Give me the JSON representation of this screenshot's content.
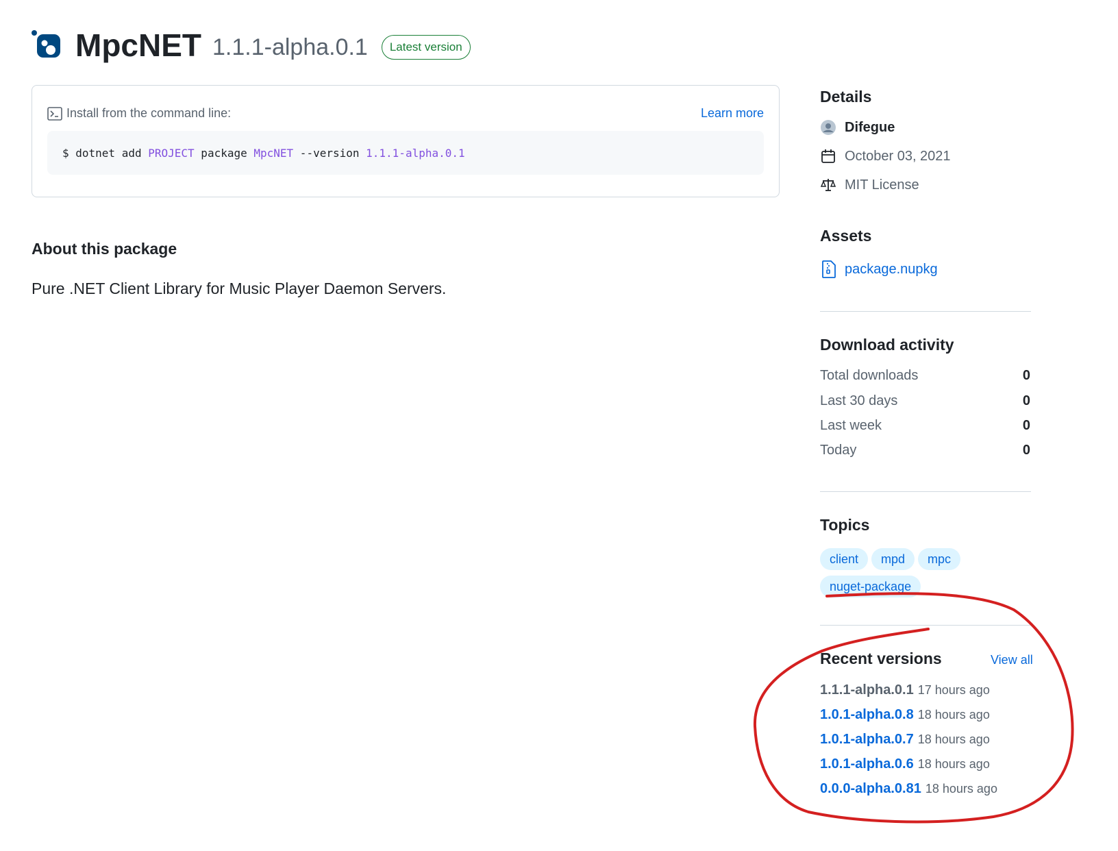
{
  "header": {
    "package_name": "MpcNET",
    "version": "1.1.1-alpha.0.1",
    "badge": "Latest version"
  },
  "install": {
    "label": "Install from the command line:",
    "learn_more": "Learn more",
    "command": {
      "prefix": "$ dotnet add ",
      "project": "PROJECT",
      "mid": " package ",
      "package": "MpcNET",
      "flag": " --version ",
      "version": "1.1.1-alpha.0.1"
    }
  },
  "about": {
    "title": "About this package",
    "description": "Pure .NET Client Library for Music Player Daemon Servers."
  },
  "details": {
    "title": "Details",
    "author": "Difegue",
    "date": "October 03, 2021",
    "license": "MIT License"
  },
  "assets": {
    "title": "Assets",
    "file": "package.nupkg"
  },
  "downloads": {
    "title": "Download activity",
    "rows": [
      {
        "label": "Total downloads",
        "value": "0"
      },
      {
        "label": "Last 30 days",
        "value": "0"
      },
      {
        "label": "Last week",
        "value": "0"
      },
      {
        "label": "Today",
        "value": "0"
      }
    ]
  },
  "topics": {
    "title": "Topics",
    "items": [
      "client",
      "mpd",
      "mpc",
      "nuget-package"
    ]
  },
  "recent_versions": {
    "title": "Recent versions",
    "view_all": "View all",
    "items": [
      {
        "version": "1.1.1-alpha.0.1",
        "time": "17 hours ago"
      },
      {
        "version": "1.0.1-alpha.0.8",
        "time": "18 hours ago"
      },
      {
        "version": "1.0.1-alpha.0.7",
        "time": "18 hours ago"
      },
      {
        "version": "1.0.1-alpha.0.6",
        "time": "18 hours ago"
      },
      {
        "version": "0.0.0-alpha.0.81",
        "time": "18 hours ago"
      }
    ]
  },
  "colors": {
    "link": "#0969da",
    "badge_green": "#1a7f37",
    "annotation_red": "#d42020",
    "brand_blue": "#004880"
  }
}
